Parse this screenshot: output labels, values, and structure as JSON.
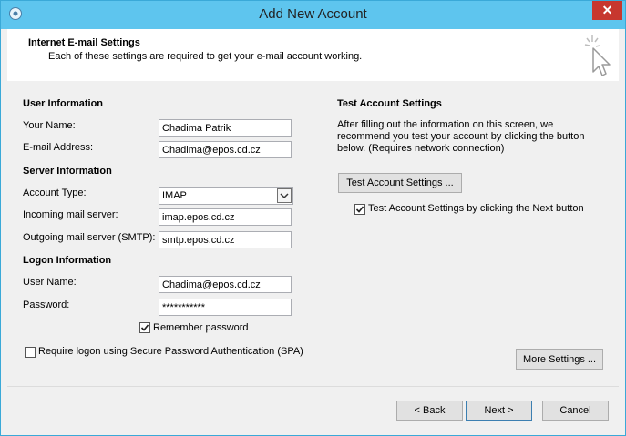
{
  "window": {
    "title": "Add New Account",
    "close_label": "✕"
  },
  "header": {
    "title": "Internet E-mail Settings",
    "subtitle": "Each of these settings are required to get your e-mail account working."
  },
  "user_info": {
    "section": "User Information",
    "name_label": "Your Name:",
    "name_value": "Chadima Patrik",
    "email_label": "E-mail Address:",
    "email_value": "Chadima@epos.cd.cz"
  },
  "server_info": {
    "section": "Server Information",
    "account_type_label": "Account Type:",
    "account_type_value": "IMAP",
    "incoming_label": "Incoming mail server:",
    "incoming_value": "imap.epos.cd.cz",
    "outgoing_label": "Outgoing mail server (SMTP):",
    "outgoing_value": "smtp.epos.cd.cz"
  },
  "logon_info": {
    "section": "Logon Information",
    "username_label": "User Name:",
    "username_value": "Chadima@epos.cd.cz",
    "password_label": "Password:",
    "password_value": "***********",
    "remember_label": "Remember password",
    "remember_checked": true,
    "spa_label": "Require logon using Secure Password Authentication (SPA)",
    "spa_checked": false
  },
  "test": {
    "section": "Test Account Settings",
    "description": "After filling out the information on this screen, we recommend you test your account by clicking the button below. (Requires network connection)",
    "button_label": "Test Account Settings ...",
    "next_check_label": "Test Account Settings by clicking the Next button",
    "next_check_checked": true
  },
  "buttons": {
    "more_settings": "More Settings ...",
    "back": "< Back",
    "next": "Next >",
    "cancel": "Cancel"
  },
  "colors": {
    "titlebar": "#5ec5ee",
    "close_button": "#c7372f",
    "window_bg": "#f0f0f0"
  }
}
